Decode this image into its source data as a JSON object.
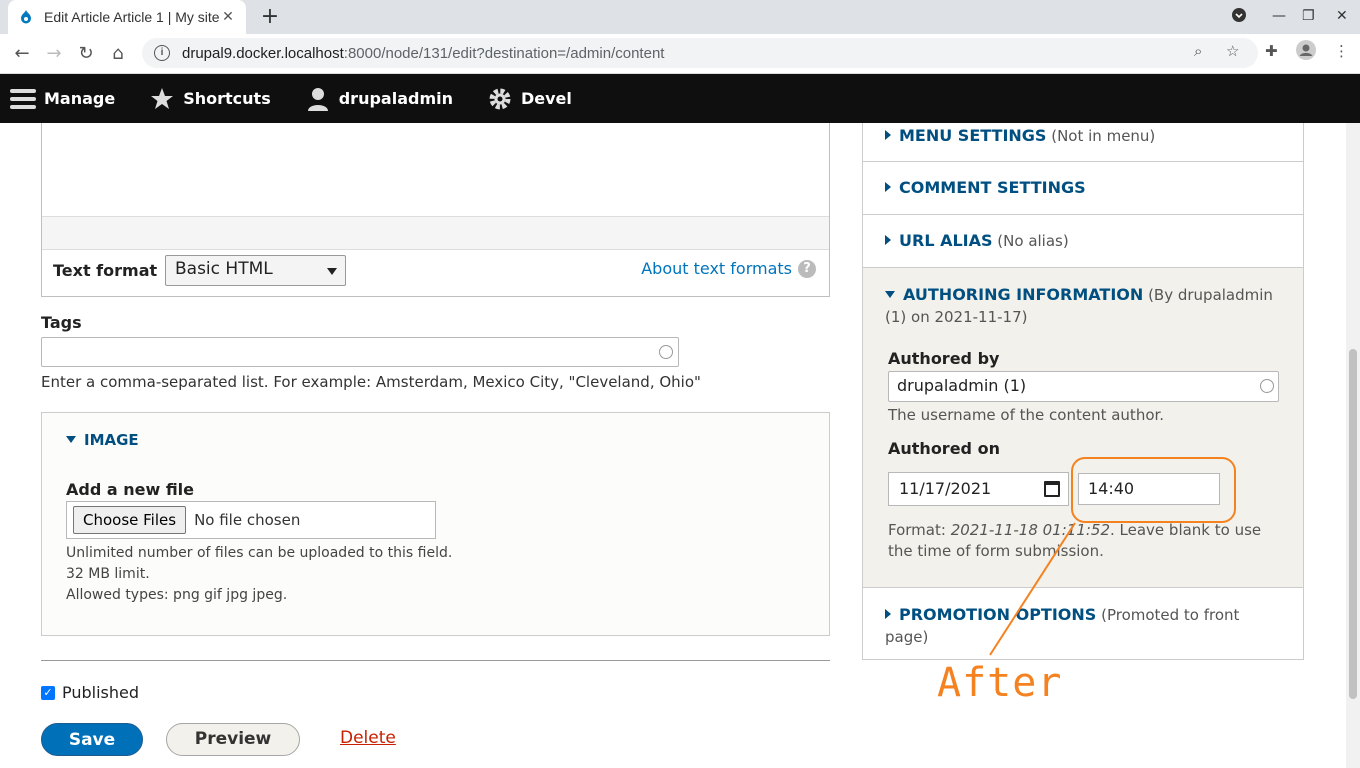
{
  "browser": {
    "tab_title": "Edit Article Article 1 | My site",
    "url_host": "drupal9.docker.localhost",
    "url_path": ":8000/node/131/edit?destination=/admin/content"
  },
  "toolbar": {
    "manage": "Manage",
    "shortcuts": "Shortcuts",
    "user": "drupaladmin",
    "devel": "Devel"
  },
  "editor": {
    "text_format_label": "Text format",
    "text_format_value": "Basic HTML",
    "about_text_formats": "About text formats"
  },
  "tags": {
    "label": "Tags",
    "value": "",
    "description": "Enter a comma-separated list. For example: Amsterdam, Mexico City, \"Cleveland, Ohio\""
  },
  "image": {
    "title": "IMAGE",
    "add_label": "Add a new file",
    "choose_button": "Choose Files",
    "no_file": "No file chosen",
    "desc_line1": "Unlimited number of files can be uploaded to this field.",
    "desc_line2": "32 MB limit.",
    "desc_line3": "Allowed types: png gif jpg jpeg."
  },
  "form": {
    "published_label": "Published",
    "published_checked": true,
    "save": "Save",
    "preview": "Preview",
    "delete": "Delete"
  },
  "sidebar": {
    "menu_settings": "MENU SETTINGS",
    "menu_settings_sub": "(Not in menu)",
    "comment_settings": "COMMENT SETTINGS",
    "url_alias": "URL ALIAS",
    "url_alias_sub": "(No alias)",
    "authoring_info": "AUTHORING INFORMATION",
    "authoring_info_sub_1": "(By drupaladmin",
    "authoring_info_sub_2": "(1) on 2021-11-17)",
    "authored_by_label": "Authored by",
    "authored_by_value": "drupaladmin (1)",
    "authored_by_desc": "The username of the content author.",
    "authored_on_label": "Authored on",
    "date_value": "11/17/2021",
    "time_value": "14:40",
    "format_prefix": "Format: ",
    "format_example": "2021-11-18 01:11:52",
    "format_suffix": ". Leave blank to use the time of form submission.",
    "promotion_options": "PROMOTION OPTIONS",
    "promotion_sub_1": "(Promoted to front",
    "promotion_sub_2": "page)"
  },
  "annotation": {
    "text": "After",
    "color": "#f58220"
  }
}
